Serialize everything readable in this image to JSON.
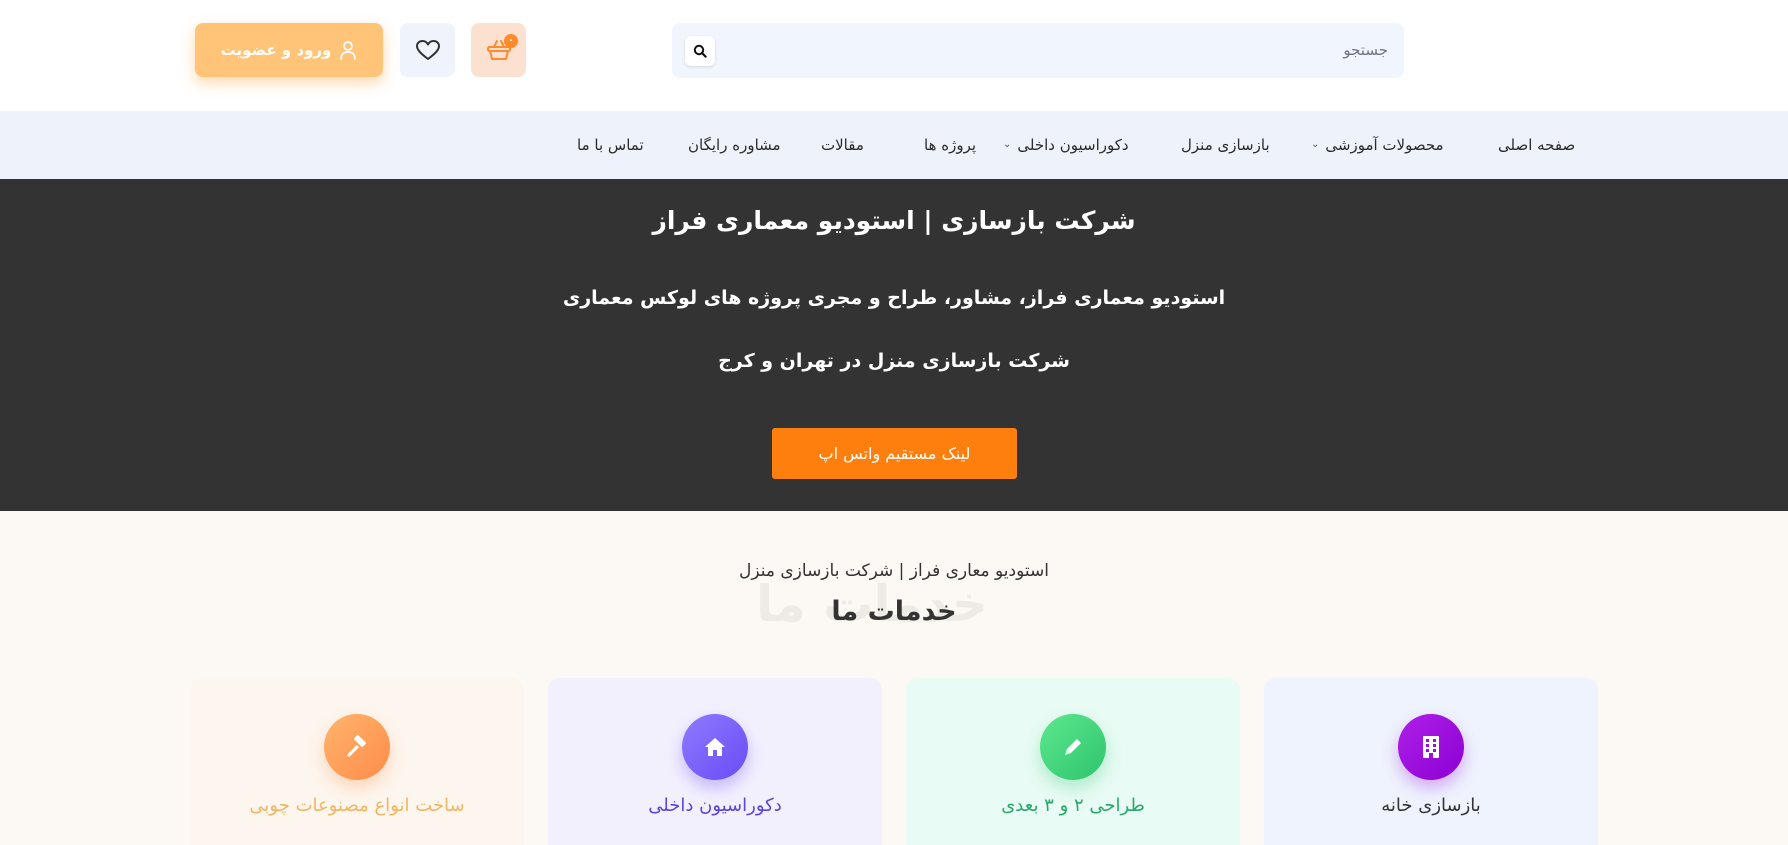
{
  "header": {
    "search": {
      "placeholder": "جستجو"
    },
    "cart": {
      "count": "۰"
    },
    "login": {
      "label": "ورود و عضویت"
    }
  },
  "nav": {
    "items": [
      {
        "label": "صفحه اصلی"
      },
      {
        "label": "محصولات آموزشی"
      },
      {
        "label": "بازسازی منزل"
      },
      {
        "label": "دکوراسیون داخلی"
      },
      {
        "label": "پروژه ها"
      },
      {
        "label": "مقالات"
      },
      {
        "label": "مشاوره رایگان"
      },
      {
        "label": "تماس با ما"
      }
    ]
  },
  "hero": {
    "title": "شرکت بازسازی | استودیو معماری فراز",
    "line1": "استودیو معماری فراز، مشاور، طراح و مجری پروژه های لوکس معماری",
    "line2": "شرکت بازسازی منزل در تهران و کرج",
    "button": "لینک مستقیم واتس اپ"
  },
  "services": {
    "subtitle": "استودیو معاری فراز | شرکت بازسازی منزل",
    "ghost": "خدمات ما",
    "title": "خدمات ما",
    "cards": [
      {
        "label": "بازسازی خانه"
      },
      {
        "label": "طراحی ۲ و ۳ بعدی"
      },
      {
        "label": "دکوراسیون داخلی"
      },
      {
        "label": "ساخت انواع مصنوعات چوبی"
      }
    ]
  },
  "colors": {
    "accent_orange": "#ff7f0e",
    "login_button": "#ffc478",
    "nav_background": "#eef3fb",
    "hero_background": "#333333"
  }
}
